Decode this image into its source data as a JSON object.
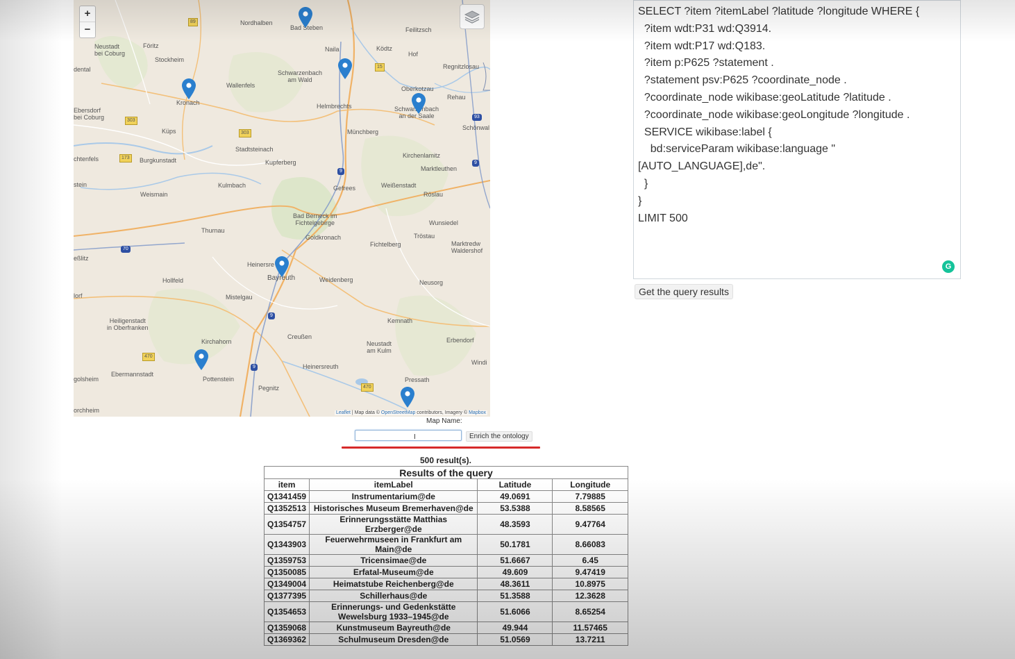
{
  "map": {
    "zoom_in": "+",
    "zoom_out": "−",
    "attribution": {
      "leaflet": "Leaflet",
      "sep1": " | Map data © ",
      "osm": "OpenStreetMap",
      "mid": " contributors, Imagery © ",
      "mapbox": "Mapbox"
    },
    "places": {
      "nordhalben": "Nordhalben",
      "bad_steben": "Bad Steben",
      "feilitzsch": "Feilitzsch",
      "neustadt_coburg": "Neustadt\nbei Coburg",
      "foritz": "Föritz",
      "stockheim": "Stockheim",
      "naila": "Naila",
      "kodtz": "Ködtz",
      "hof": "Hof",
      "regnitzlosau": "Regnitzlosau",
      "rodental": "dental",
      "schwarzenbach_wald": "Schwarzenbach\nam Wald",
      "wallenfels": "Wallenfels",
      "oberkotzau": "Oberkotzau",
      "rehau": "Rehau",
      "kronach": "Kronach",
      "helmbrechts": "Helmbrechts",
      "schwarzenbach_saale": "Schwarzenbach\nan der Saale",
      "ebersdorf": "Ebersdorf\nbei Coburg",
      "schonwald": "Schönwal",
      "kups": "Küps",
      "munchberg": "Münchberg",
      "stadtsteinach": "Stadtsteinach",
      "lichtenfels": "chtenfels",
      "burgkunstadt": "Burgkunstadt",
      "kupferberg": "Kupferberg",
      "kirchenlamitz": "Kirchenlamitz",
      "marktleuthen": "Marktleuthen",
      "stein": "stein",
      "kulmbach": "Kulmbach",
      "gefrees": "Gefrees",
      "weissenstadt": "Weißenstadt",
      "weismain": "Weismain",
      "roslau": "Röslau",
      "bad_berneck": "Bad Berneck im\nFichtelgebirge",
      "wunsiedel": "Wunsiedel",
      "thurnau": "Thurnau",
      "goldkronach": "Goldkronach",
      "trostau": "Tröstau",
      "fichtelberg": "Fichtelberg",
      "marktredwitz": "Marktredw\nWaldershof",
      "seblitz": "eßlitz",
      "heinersreuth": "Heinersre",
      "hollfeld": "Hollfeld",
      "bayreuth": "Bayreuth",
      "weidenberg": "Weidenberg",
      "neusorg": "Neusorg",
      "dorf": "lorf",
      "mistelgau": "Mistelgau",
      "heiligenstadt": "Heiligenstadt\nin Oberfranken",
      "kemnath": "Kemnath",
      "creussen": "Creußen",
      "kirchahorn": "Kirchahorn",
      "neustadt_kulm": "Neustadt\nam Kulm",
      "erbendorf": "Erbendorf",
      "windi": "Windi",
      "pottenstein": "Pottenstein",
      "ebermannstadt": "Ebermannstadt",
      "heinersreuth2": "Heinersreuth",
      "golsheim": "golsheim",
      "pegnitz": "Pegnitz",
      "pressath": "Pressath",
      "forchheim": "orchheim"
    },
    "road_shields": {
      "s89": "89",
      "s303a": "303",
      "s303b": "303",
      "s173": "173",
      "s470": "470",
      "s470b": "470",
      "s15": "15",
      "a9a": "9",
      "a9b": "9",
      "a70": "70",
      "a93": "93",
      "a9c": "9",
      "a9d": "9"
    }
  },
  "query": {
    "text": "SELECT ?item ?itemLabel ?latitude ?longitude WHERE {\n  ?item wdt:P31 wd:Q3914.\n  ?item wdt:P17 wd:Q183.\n  ?item p:P625 ?statement .\n  ?statement psv:P625 ?coordinate_node .\n  ?coordinate_node wikibase:geoLatitude ?latitude .\n  ?coordinate_node wikibase:geoLongitude ?longitude .\n  SERVICE wikibase:label {\n    bd:serviceParam wikibase:language \"\n[AUTO_LANGUAGE],de\".\n  }\n}\nLIMIT 500",
    "grammarly_icon": "G",
    "button_label": "Get the query results"
  },
  "map_name": {
    "label": "Map Name:",
    "input_value": "",
    "cursor": "I",
    "enrich_label": "Enrich the ontology"
  },
  "results": {
    "count_text": "500 result(s).",
    "caption": "Results of the query",
    "headers": [
      "item",
      "itemLabel",
      "Latitude",
      "Longitude"
    ],
    "rows": [
      [
        "Q1341459",
        "Instrumentarium@de",
        "49.0691",
        "7.79885"
      ],
      [
        "Q1352513",
        "Historisches Museum Bremerhaven@de",
        "53.5388",
        "8.58565"
      ],
      [
        "Q1354757",
        "Erinnerungsstätte Matthias Erzberger@de",
        "48.3593",
        "9.47764"
      ],
      [
        "Q1343903",
        "Feuerwehrmuseen in Frankfurt am Main@de",
        "50.1781",
        "8.66083"
      ],
      [
        "Q1359753",
        "Tricensimae@de",
        "51.6667",
        "6.45"
      ],
      [
        "Q1350085",
        "Erfatal-Museum@de",
        "49.609",
        "9.47419"
      ],
      [
        "Q1349004",
        "Heimatstube Reichenberg@de",
        "48.3611",
        "10.8975"
      ],
      [
        "Q1377395",
        "Schillerhaus@de",
        "51.3588",
        "12.3628"
      ],
      [
        "Q1354653",
        "Erinnerungs- und Gedenkstätte Wewelsburg 1933–1945@de",
        "51.6066",
        "8.65254"
      ],
      [
        "Q1359068",
        "Kunstmuseum Bayreuth@de",
        "49.944",
        "11.57465"
      ],
      [
        "Q1369362",
        "Schulmuseum Dresden@de",
        "51.0569",
        "13.7211"
      ]
    ]
  },
  "colors": {
    "marker": "#2a7fce",
    "accent_line": "#d62a2a",
    "grammarly": "#15c39a"
  }
}
